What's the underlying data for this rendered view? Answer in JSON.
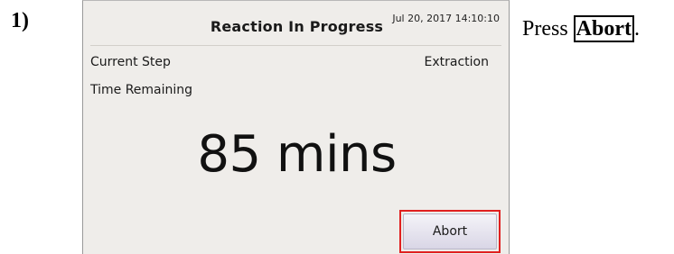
{
  "step_number": "1)",
  "screen": {
    "title": "Reaction In Progress",
    "datetime": "Jul 20, 2017  14:10:10",
    "current_step_label": "Current Step",
    "current_step_value": "Extraction",
    "time_remaining_label": "Time Remaining",
    "time_remaining_value": "85 mins",
    "abort_label": "Abort"
  },
  "instruction": {
    "prefix": "Press ",
    "keyword": "Abort",
    "suffix": "."
  },
  "colors": {
    "screen_background": "#efedea",
    "highlight": "#e02020",
    "button_fill": "#d9d6e6"
  }
}
